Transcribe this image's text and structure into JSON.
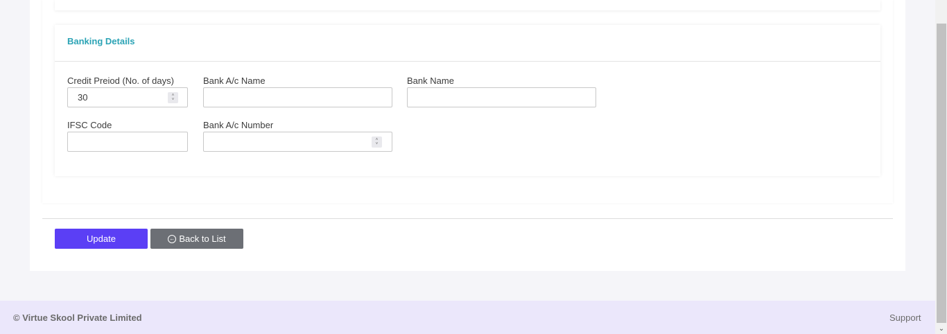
{
  "banking": {
    "title": "Banking Details",
    "credit_period": {
      "label": "Credit Preiod (No. of days)",
      "value": "30"
    },
    "bank_ac_name": {
      "label": "Bank A/c Name",
      "value": ""
    },
    "bank_name": {
      "label": "Bank Name",
      "value": ""
    },
    "ifsc": {
      "label": "IFSC Code",
      "value": ""
    },
    "bank_ac_number": {
      "label": "Bank A/c Number",
      "value": ""
    }
  },
  "actions": {
    "update_label": "Update",
    "back_label": "Back to List",
    "back_icon": "circle-arrow-left-icon"
  },
  "footer": {
    "copyright": "© Virtue Skool Private Limited",
    "support": "Support"
  },
  "colors": {
    "accent": "#5b3ff5",
    "title": "#2ba3b5",
    "secondary_button": "#6c6f75",
    "footer_bg": "#ebe7fb"
  }
}
